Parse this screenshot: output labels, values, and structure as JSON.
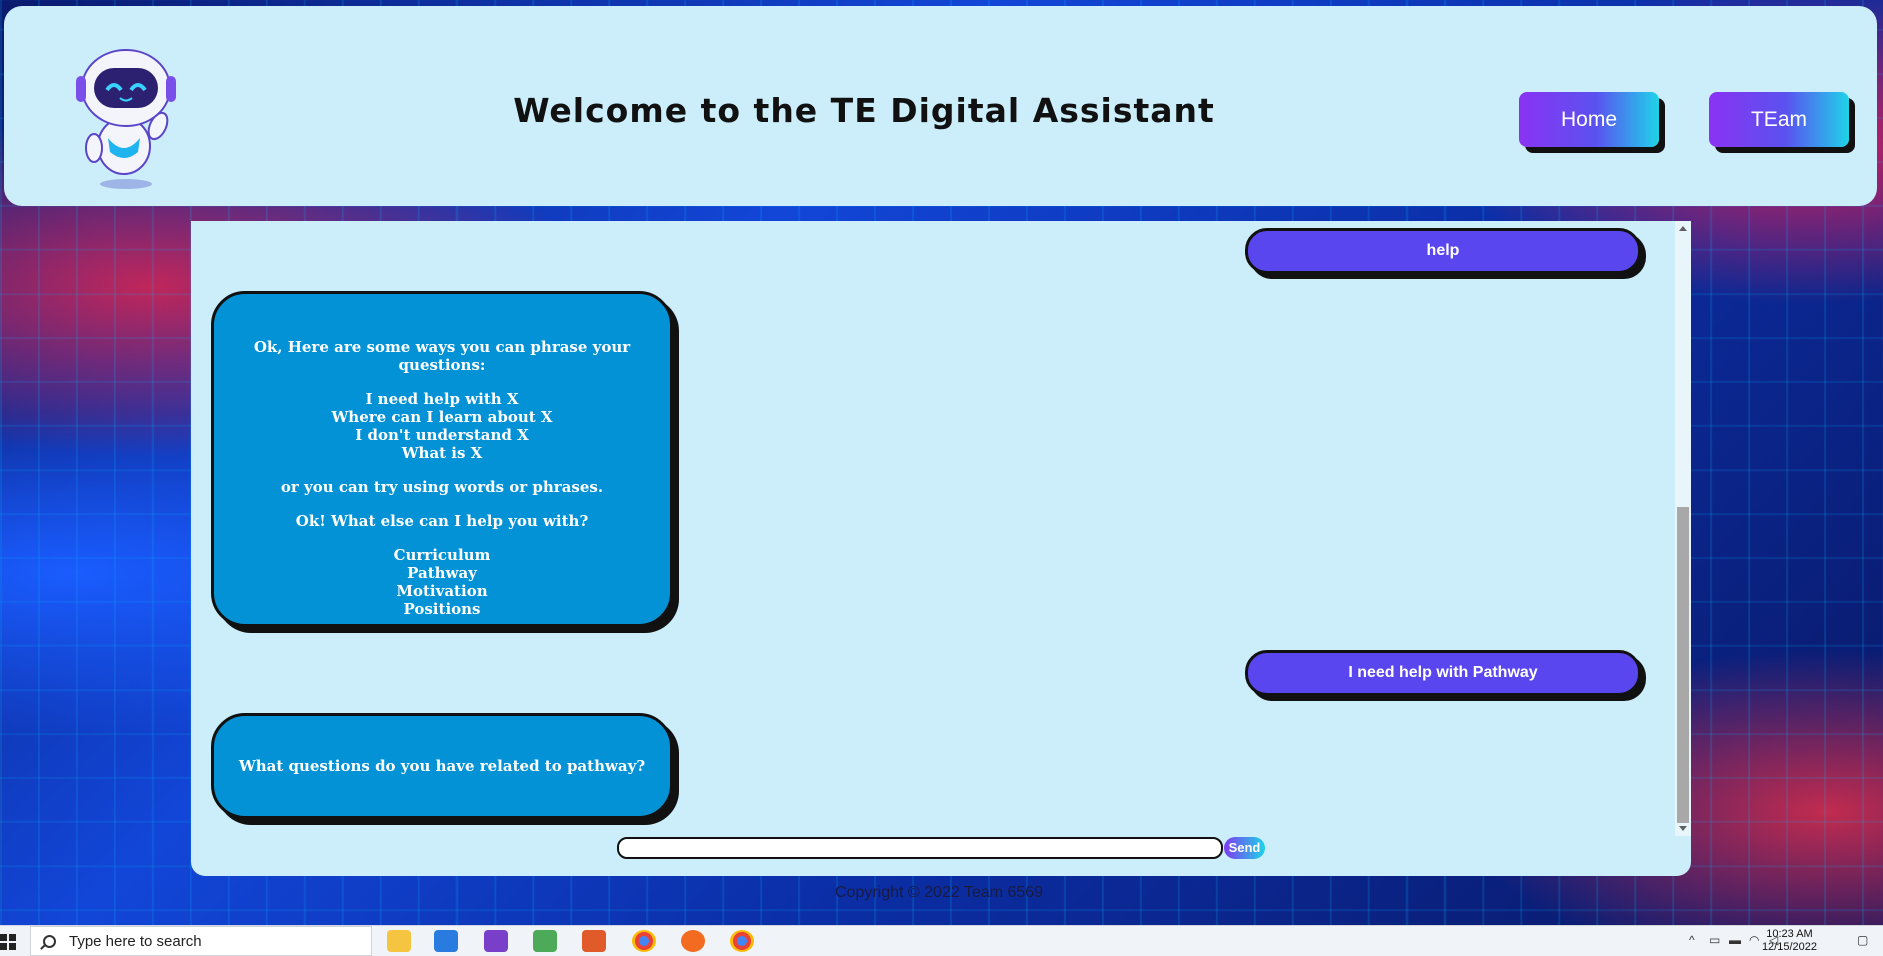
{
  "header": {
    "title": "Welcome to the TE Digital Assistant",
    "nav": [
      {
        "label": "Home"
      },
      {
        "label": "TEam"
      }
    ]
  },
  "chat": {
    "messages": [
      {
        "from": "user",
        "text": "help"
      },
      {
        "from": "bot",
        "paragraphs": [
          [
            "Ok, Here are some ways you can phrase your questions:"
          ],
          [
            "I need help with X",
            "Where can I learn about X",
            "I don't understand X",
            "What is X"
          ],
          [
            "or you can try using words or phrases."
          ],
          [
            "Ok! What else can I help you with?"
          ],
          [
            "Curriculum",
            "Pathway",
            "Motivation",
            "Positions"
          ]
        ]
      },
      {
        "from": "user",
        "text": "I need help with Pathway"
      },
      {
        "from": "bot",
        "paragraphs": [
          [
            "What questions do you have related to pathway?"
          ]
        ]
      }
    ],
    "input": {
      "value": "",
      "placeholder": ""
    },
    "send_label": "Send"
  },
  "footer": {
    "copyright": "Copyright © 2022 Team 6569"
  },
  "taskbar": {
    "search_placeholder": "Type here to search",
    "time": "10:23 AM",
    "date": "12/15/2022"
  },
  "colors": {
    "panel": "#cceefb",
    "user_bubble": "#5a46ef",
    "bot_bubble": "#0392d6",
    "nav_gradient_start": "#8a33f2",
    "nav_gradient_end": "#1fd3e8"
  }
}
